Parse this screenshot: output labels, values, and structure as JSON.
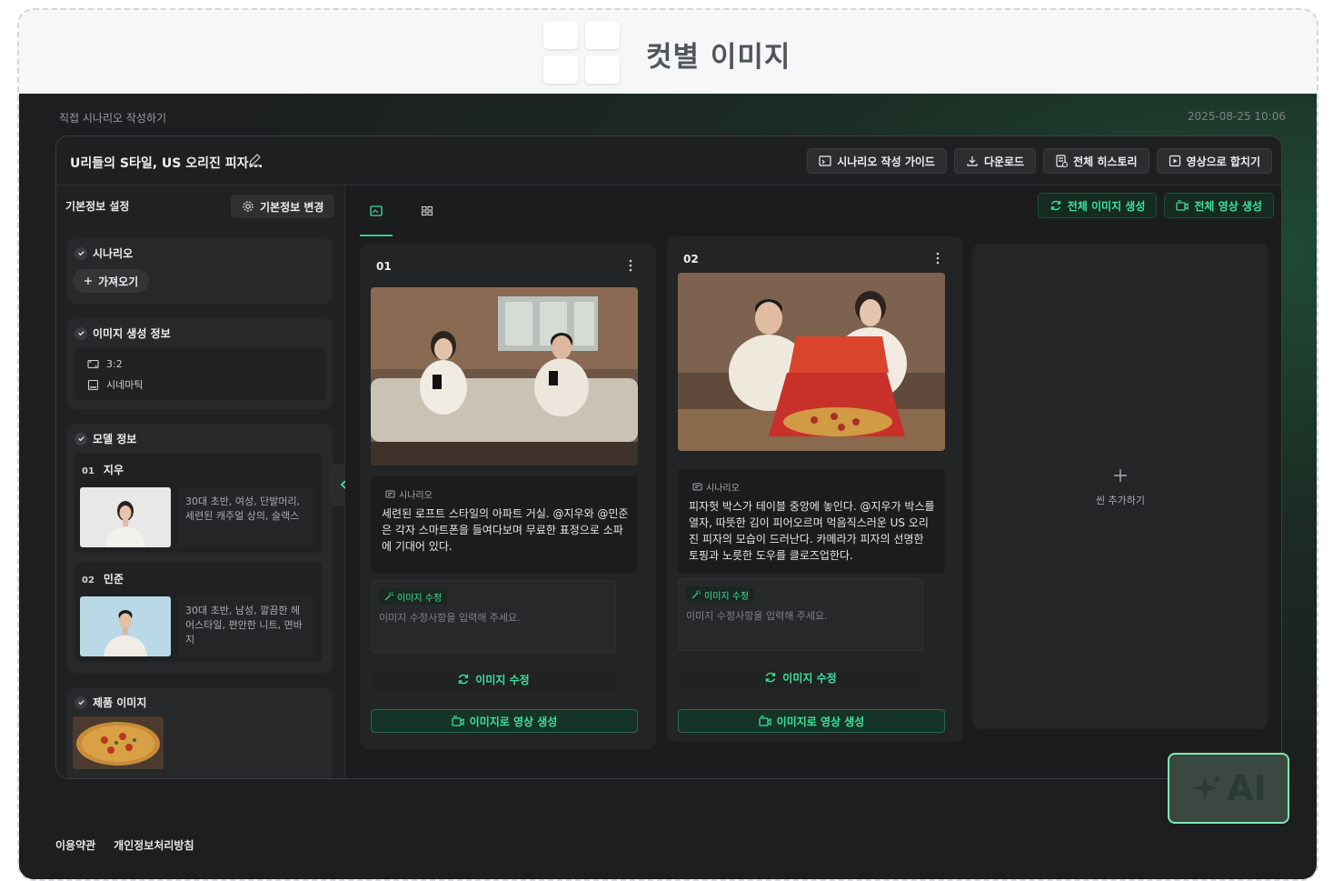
{
  "header": {
    "title": "컷별 이미지"
  },
  "app": {
    "breadcrumb": "직접 시나리오 작성하기",
    "timestamp": "2025-08-25 10:06",
    "project_title": "U리들의 S타일, US 오리진 피자...",
    "top_buttons": [
      "시나리오 작성 가이드",
      "다운로드",
      "전체 히스토리",
      "영상으로 합치기"
    ]
  },
  "sidebar": {
    "heading": "기본정보 설정",
    "change_button": "기본정보 변경",
    "scenario": {
      "title": "시나리오",
      "import_button": "가져오기"
    },
    "image_info": {
      "title": "이미지 생성 정보",
      "ratio": "3:2",
      "style": "시네마틱"
    },
    "model_info": {
      "title": "모델 정보",
      "models": [
        {
          "num": "01",
          "name": "지우",
          "desc": "30대 초반, 여성, 단발머리, 세련된 캐주얼 상의, 슬랙스"
        },
        {
          "num": "02",
          "name": "민준",
          "desc": "30대 초반, 남성, 깔끔한 헤어스타일, 편안한 니트, 면바지"
        }
      ]
    },
    "product": {
      "title": "제품 이미지"
    }
  },
  "main": {
    "gen_buttons": [
      "전체 이미지 생성",
      "전체 영상 생성"
    ],
    "cards": [
      {
        "num": "01",
        "scenario_label": "시나리오",
        "scenario_text": "세련된 로프트 스타일의 아파트 거실. @지우와 @민준은 각자 스마트폰을 들여다보며 무료한 표정으로 소파에 기대어 있다.",
        "edit_tag": "이미지 수정",
        "edit_placeholder": "이미지 수정사항을 입력해 주세요.",
        "edit_button": "이미지 수정",
        "video_button": "이미지로 영상 생성"
      },
      {
        "num": "02",
        "scenario_label": "시나리오",
        "scenario_text": "피자헛 박스가 테이블 중앙에 놓인다. @지우가 박스를 열자, 따뜻한 김이 피어오르며 먹음직스러운 US 오리진 피자의 모습이 드러난다. 카메라가 피자의 선명한 토핑과 노릇한 도우를 클로즈업한다.",
        "edit_tag": "이미지 수정",
        "edit_placeholder": "이미지 수정사항을 입력해 주세요.",
        "edit_button": "이미지 수정",
        "video_button": "이미지로 영상 생성"
      }
    ],
    "add_scene": "씬 추가하기"
  },
  "footer": {
    "terms": "이용약관",
    "privacy": "개인정보처리방침"
  },
  "ai_button": "AI",
  "colors": {
    "accent": "#3ee09a",
    "background": "#1d1e1f"
  }
}
